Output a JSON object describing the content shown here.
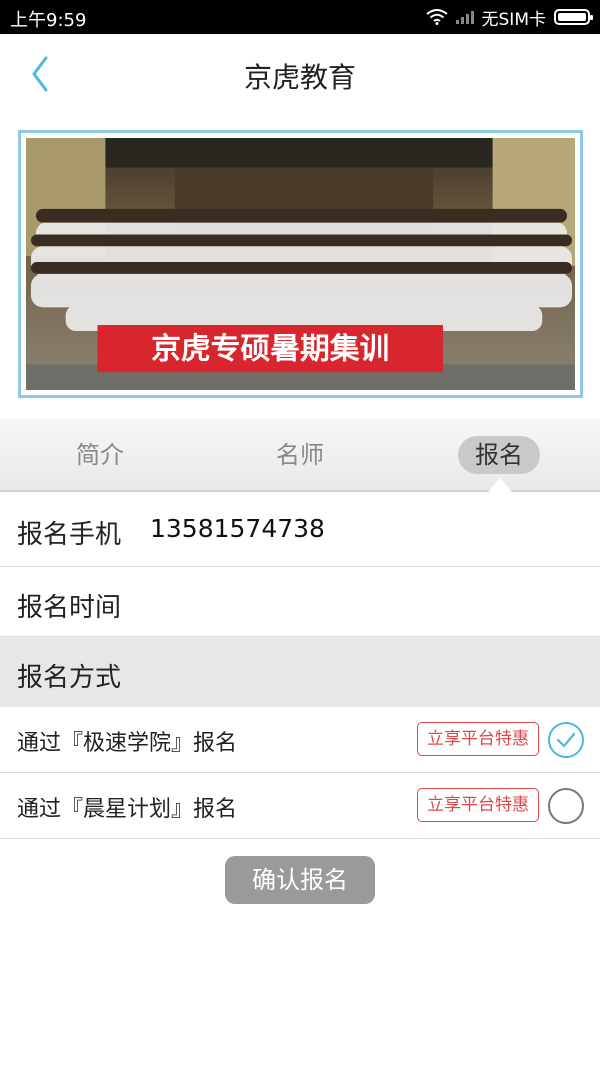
{
  "status_bar": {
    "time": "上午9:59",
    "carrier": "无SIM卡",
    "icons": [
      "wifi-icon",
      "signal-icon",
      "battery-icon"
    ]
  },
  "header": {
    "title": "京虎教育",
    "back_icon": "chevron-left-icon"
  },
  "banner": {
    "sign_text": "京虎专硕暑期集训",
    "image": "group-photo"
  },
  "tabs": [
    {
      "label": "简介",
      "active": false
    },
    {
      "label": "名师",
      "active": false
    },
    {
      "label": "报名",
      "active": true
    }
  ],
  "form": {
    "phone_label": "报名手机",
    "phone_value": "13581574738",
    "time_label": "报名时间",
    "method_label": "报名方式",
    "options": [
      {
        "label": "通过『极速学院』报名",
        "badge": "立享平台特惠",
        "selected": true
      },
      {
        "label": "通过『晨星计划』报名",
        "badge": "立享平台特惠",
        "selected": false
      }
    ]
  },
  "confirm_button": "确认报名",
  "colors": {
    "accent": "#4bb9dc",
    "badge": "#e04848",
    "button": "#9a9a9a"
  }
}
